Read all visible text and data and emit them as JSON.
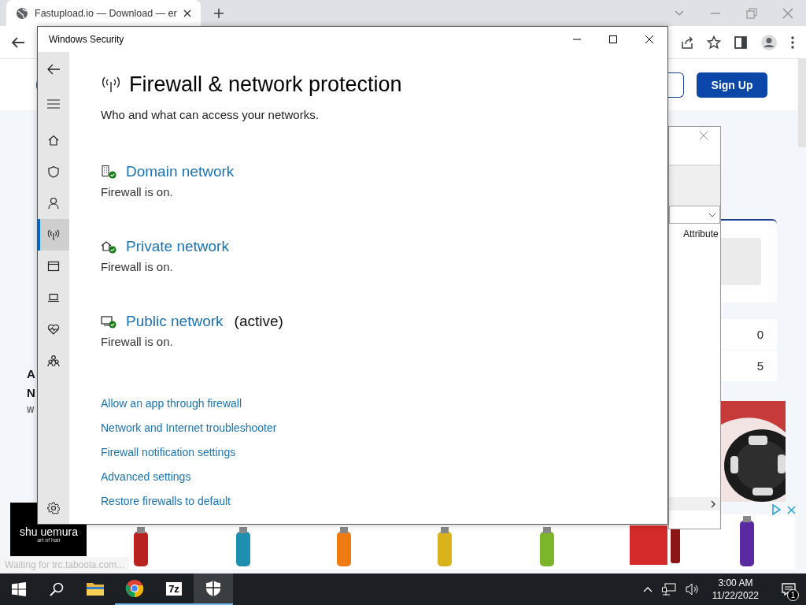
{
  "browser": {
    "tabs": [
      {
        "title": "Fastupload.io — Download — er",
        "selected": true
      }
    ],
    "page": {
      "sign_up": "Sign Up",
      "heading_fragments": [
        "A",
        "N"
      ],
      "text_fragment": "W",
      "stat_values": [
        "0",
        "5"
      ],
      "status": "Waiting for trc.taboola.com..."
    },
    "ad": {
      "brand": "shu uemura",
      "tagline": "art of hair"
    }
  },
  "background_window": {
    "column_header": "Attribute"
  },
  "security_window": {
    "title": "Windows Security",
    "heading": "Firewall & network protection",
    "subtitle": "Who and what can access your networks.",
    "nav": [
      {
        "kind": "home",
        "selected": false
      },
      {
        "kind": "shield",
        "selected": false
      },
      {
        "kind": "person",
        "selected": false
      },
      {
        "kind": "antenna",
        "selected": true
      },
      {
        "kind": "browser",
        "selected": false
      },
      {
        "kind": "laptop",
        "selected": false
      },
      {
        "kind": "heart",
        "selected": false
      },
      {
        "kind": "family",
        "selected": false
      }
    ],
    "networks": [
      {
        "kind": "domain",
        "name": "Domain network",
        "status": "Firewall is on."
      },
      {
        "kind": "private",
        "name": "Private network",
        "status": "Firewall is on."
      },
      {
        "kind": "public",
        "name": "Public network",
        "badge": "(active)",
        "status": "Firewall is on."
      }
    ],
    "links": [
      "Allow an app through firewall",
      "Network and Internet troubleshooter",
      "Firewall notification settings",
      "Advanced settings",
      "Restore firewalls to default"
    ]
  },
  "taskbar": {
    "apps": [
      {
        "kind": "folder",
        "running": false,
        "selected": false
      },
      {
        "kind": "chrome",
        "running": true,
        "selected": false
      },
      {
        "kind": "archive",
        "label": "7z",
        "running": true,
        "selected": false
      },
      {
        "kind": "shield",
        "running": true,
        "selected": true
      }
    ],
    "time": "3:00 AM",
    "date": "11/22/2022",
    "notifications": "1"
  }
}
